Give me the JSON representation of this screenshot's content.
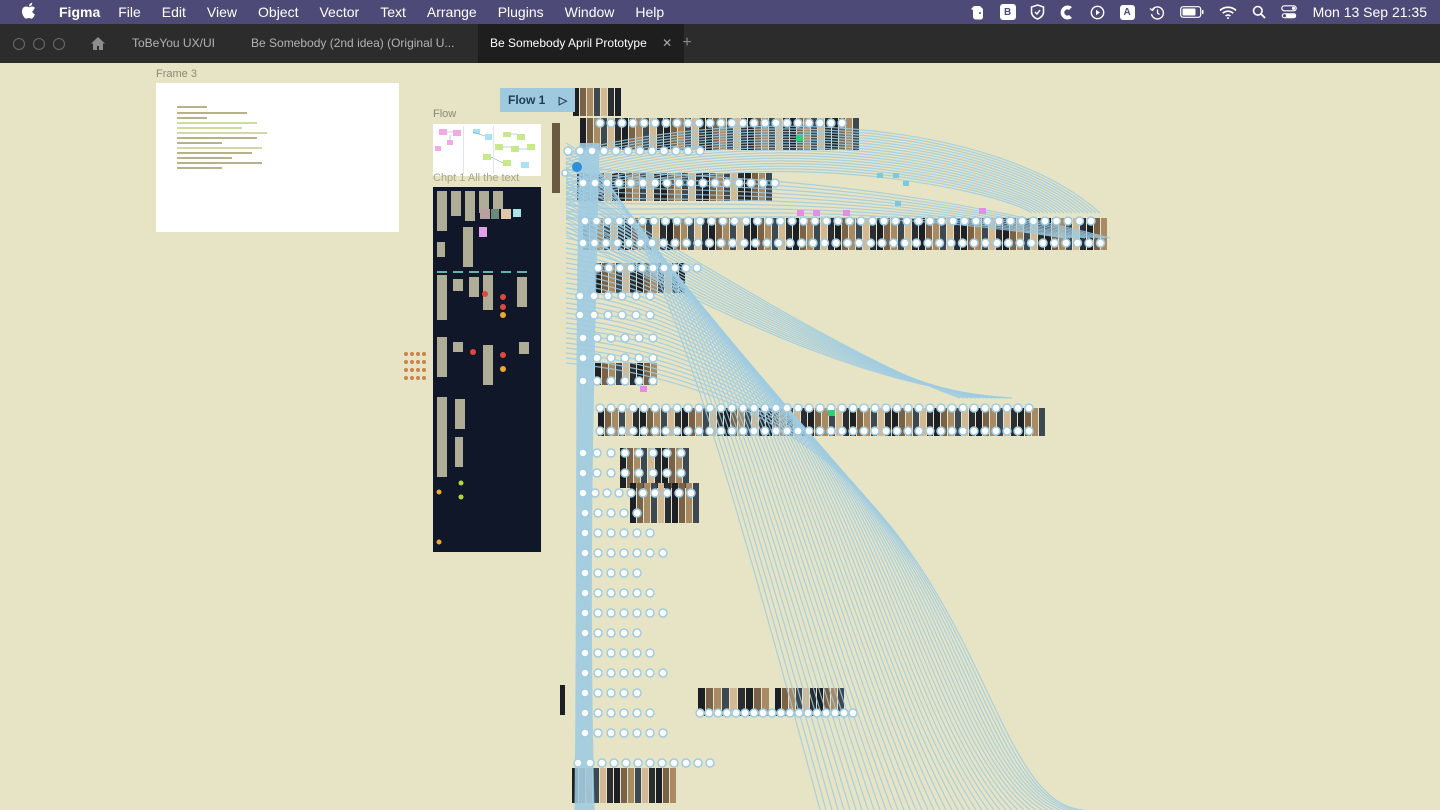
{
  "menubar": {
    "app": "Figma",
    "menus": [
      "File",
      "Edit",
      "View",
      "Object",
      "Vector",
      "Text",
      "Arrange",
      "Plugins",
      "Window",
      "Help"
    ],
    "clock": "Mon 13 Sep  21:35",
    "status_icons": [
      "evernote-icon",
      "bear-icon",
      "vpn-shield-icon",
      "clipboard-icon",
      "play-circle-icon",
      "input-source-icon",
      "time-machine-icon",
      "battery-icon",
      "wifi-icon",
      "spotlight-icon",
      "control-center-icon"
    ]
  },
  "tabbar": {
    "tabs": [
      {
        "label": "ToBeYou UX/UI",
        "active": false
      },
      {
        "label": "Be Somebody (2nd idea) (Original U...",
        "active": false
      },
      {
        "label": "Be Somebody April Prototype",
        "active": true
      }
    ],
    "new_tab": "+"
  },
  "canvas": {
    "frames": {
      "frame3": "Frame 3",
      "flow": "Flow",
      "chapter": "Chpt 1 All the text"
    },
    "flow_badge": "Flow 1"
  },
  "colors": {
    "menubar_bg": "#4e4a77",
    "tabbar_bg": "#2c2c2c",
    "canvas_bg": "#e6e4c4",
    "connector": "#9fcbe2",
    "chapter_bg": "#0f1729"
  }
}
